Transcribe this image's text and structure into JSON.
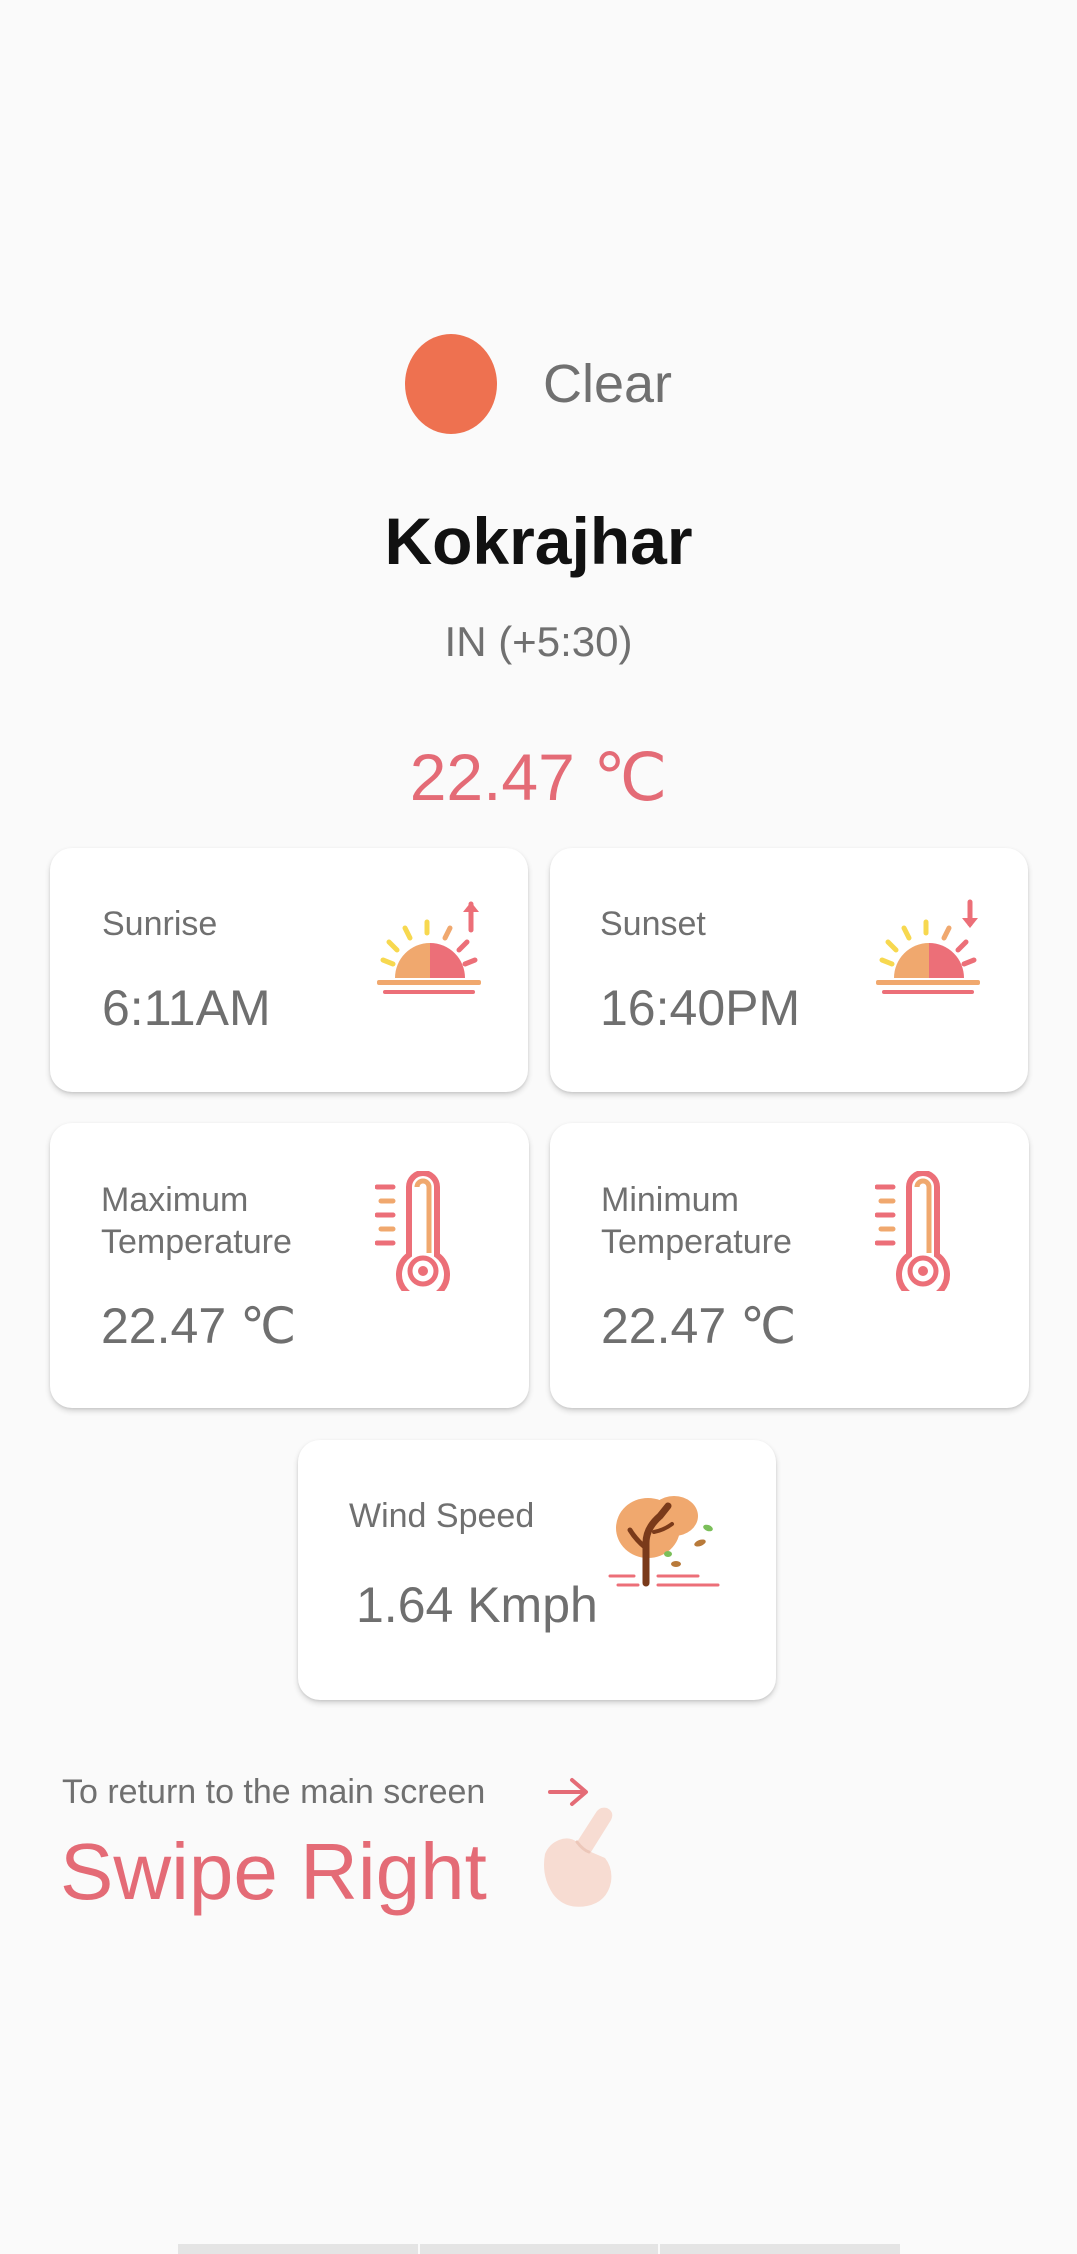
{
  "weather": {
    "condition": "Clear",
    "city": "Kokrajhar",
    "country": "IN (+5:30)",
    "temperature": "22.47 ℃"
  },
  "cards": {
    "sunrise": {
      "label": "Sunrise",
      "value": "6:11AM",
      "icon": "sunrise-icon"
    },
    "sunset": {
      "label": "Sunset",
      "value": "16:40PM",
      "icon": "sunset-icon"
    },
    "max_temp": {
      "label_line1": "Maximum",
      "label_line2": "Temperature",
      "value": "22.47 ℃",
      "icon": "thermometer-icon"
    },
    "min_temp": {
      "label_line1": "Minimum",
      "label_line2": "Temperature",
      "value": "22.47 ℃",
      "icon": "thermometer-icon"
    },
    "wind": {
      "label": "Wind Speed",
      "value": "1.64 Kmph",
      "icon": "windy-tree-icon"
    }
  },
  "hint": {
    "small": "To return to the main screen",
    "big": "Swipe Right",
    "arrow_icon": "arrow-right-icon",
    "hand_icon": "pointing-hand-icon"
  },
  "colors": {
    "accent": "#e46b76",
    "condition_dot": "#ee7150",
    "background": "#fafafa",
    "card": "#ffffff"
  }
}
